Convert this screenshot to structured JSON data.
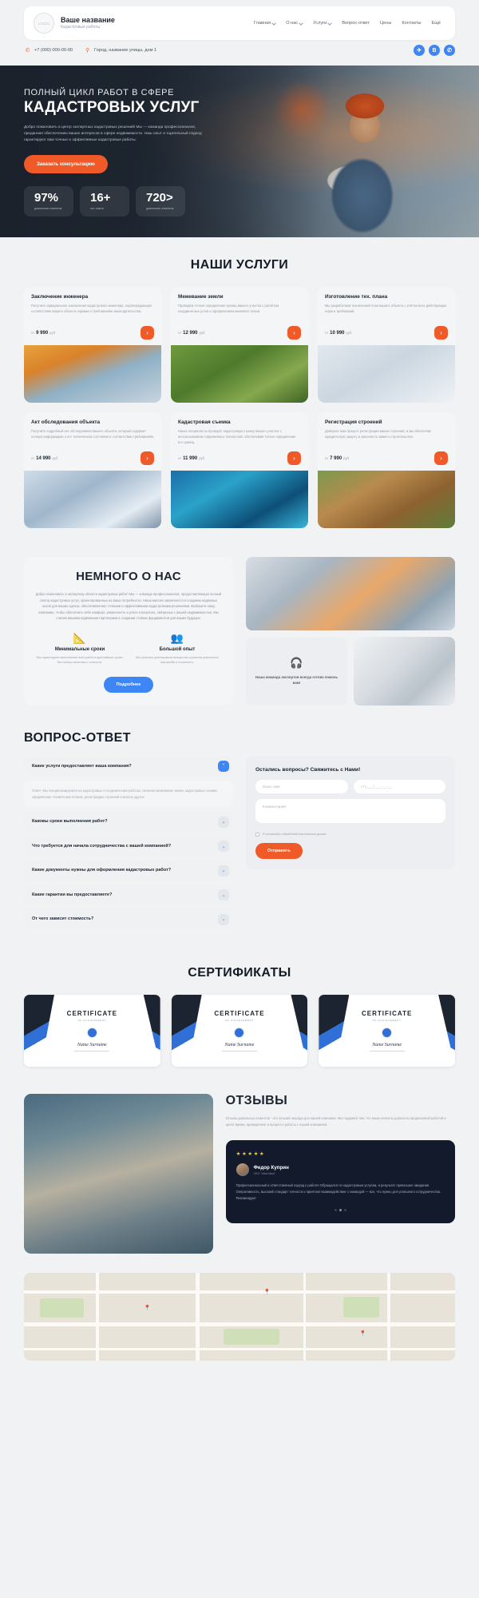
{
  "header": {
    "logo_text": "LOGO",
    "brand_name": "Ваше название",
    "brand_sub": "Кадастровые работы",
    "nav": [
      {
        "label": "Главная",
        "has_chevron": true
      },
      {
        "label": "О нас",
        "has_chevron": true
      },
      {
        "label": "Услуги",
        "has_chevron": true
      },
      {
        "label": "Вопрос-ответ",
        "has_chevron": false
      },
      {
        "label": "Цены",
        "has_chevron": false
      },
      {
        "label": "Контакты",
        "has_chevron": false
      },
      {
        "label": "Ещё",
        "has_chevron": false
      }
    ],
    "phone": "+7 (000) 000-00-00",
    "phone_icon": "phone-icon",
    "address": "Город, название улицы, дом 1",
    "address_icon": "location-pin-icon",
    "socials": [
      {
        "name": "telegram-icon",
        "glyph": "✈"
      },
      {
        "name": "vk-icon",
        "glyph": "В"
      },
      {
        "name": "whatsapp-icon",
        "glyph": "✆"
      }
    ]
  },
  "hero": {
    "superline": "ПОЛНЫЙ ЦИКЛ РАБОТ В СФЕРЕ",
    "title": "КАДАСТРОВЫХ УСЛУГ",
    "description": "Добро пожаловать в центр экспертных кадастровых решений! Мы — команда профессионалов, преданная обеспечению ваших интересов в сфере недвижимости. Наш опыт и тщательный подход гарантируют вам точные и эффективные кадастровые работы.",
    "cta_label": "Заказать консультацию",
    "stats": [
      {
        "value": "97%",
        "label": "довольных клиентов"
      },
      {
        "value": "16+",
        "label": "лет опыта"
      },
      {
        "value": "720>",
        "label": "довольных клиентов"
      }
    ]
  },
  "services": {
    "title": "НАШИ УСЛУГИ",
    "price_prefix": "от",
    "currency": "руб",
    "arrow_glyph": "›",
    "items": [
      {
        "title": "Заключение инженера",
        "desc": "Получите официальное заключение кадастрового инженера, подтверждающее соответствие вашего объекта нормам и требованиям законодательства.",
        "price": "9 990"
      },
      {
        "title": "Межевание земли",
        "desc": "Проведём точное определение границ вашего участка с расчётом координатных углов и оформлением межевого плана.",
        "price": "12 990"
      },
      {
        "title": "Изготовление тех. плана",
        "desc": "Мы разработаем технический план вашего объекта с учётом всех действующих норм и требований.",
        "price": "10 990"
      },
      {
        "title": "Акт обследования объекта",
        "desc": "Получите подробный акт обследования вашего объекта, который содержит полную информацию о его техническом состоянии и соответствии требованиям.",
        "price": "14 990"
      },
      {
        "title": "Кадастровая съемка",
        "desc": "Наша специалисты проводят кадастровую съемку вашего участка с использованием современных технологий, обеспечивая точное определение его границ.",
        "price": "11 990"
      },
      {
        "title": "Регистрация строений",
        "desc": "Доверьте нам процесс регистрации ваших строений, и мы обеспечим юридическую защиту и законность вашего строительства.",
        "price": "7 990"
      }
    ]
  },
  "about": {
    "title": "НЕМНОГО О НАС",
    "text": "Добро пожаловать в экспертизу области кадастровых работ! Мы — команда профессионалов, предоставляющая полный спектр кадастровых услуг, ориентированных на ваши потребности. Наша миссия заключается в создании надёжных основ для ваших сделок, обеспечивая вас точными и эффективными кадастровыми решениями. Выберите нашу компанию, чтобы обеспечить себе комфорт, уверенность и успех в вопросах, связанных с вашей недвижимостью. Мы станем вашими надёжными партнёрами в создании стойких фундаментов для ваших будущих.",
    "features": [
      {
        "icon": "blueprint-ruler-icon",
        "glyph": "📐",
        "title": "Минимальные сроки",
        "desc": "Мы гарантируем выполнение всех работ в кратчайшие сроки, без потери качества и точности."
      },
      {
        "icon": "team-experience-icon",
        "glyph": "👥",
        "title": "Большой опыт",
        "desc": "Мы успешно реализовали множество проектов различного масштаба и сложности."
      }
    ],
    "more_label": "Подробнее",
    "cta_icon": "headset-icon",
    "cta_glyph": "🎧",
    "cta_text": "Наша команда экспертов всегда готова помочь вам!"
  },
  "faq": {
    "title": "ВОПРОС-ОТВЕТ",
    "expand_glyph": "⌃",
    "collapse_glyph": "⌄",
    "items": [
      {
        "question": "Какие услуги предоставляет ваша компания?",
        "open": true,
        "answer": "Ответ: Мы специализируемся на кадастровых и геодезических работах, включая межевание земли, кадастровые съемки, оформление технических планов, регистрацию строений и многое другое."
      },
      {
        "question": "Каковы сроки выполнения работ?",
        "open": false,
        "answer": ""
      },
      {
        "question": "Что требуется для начала сотрудничества с вашей компанией?",
        "open": false,
        "answer": ""
      },
      {
        "question": "Какие документы нужны для оформления кадастровых работ?",
        "open": false,
        "answer": ""
      },
      {
        "question": "Какие гарантии вы предоставляете?",
        "open": false,
        "answer": ""
      },
      {
        "question": "От чего зависит стоимость?",
        "open": false,
        "answer": ""
      }
    ],
    "form": {
      "title": "Остались вопросы? Свяжитесь с Нами!",
      "name_placeholder": "Ваше имя",
      "phone_placeholder": "+7 (___) ___-__-__",
      "comment_placeholder": "Комментарий",
      "agree_text": "Я согласен(а) с обработкой персональных данных",
      "submit_label": "Отправить"
    }
  },
  "certificates": {
    "title": "СЕРТИФИКАТЫ",
    "items": [
      {
        "heading": "CERTIFICATE",
        "sub": "OF ACHIEVEMENT",
        "name": "Name Surname"
      },
      {
        "heading": "CERTIFICATE",
        "sub": "OF ACHIEVEMENT",
        "name": "Name Surname"
      },
      {
        "heading": "CERTIFICATE",
        "sub": "OF ACHIEVEMENT",
        "name": "Name Surname"
      }
    ]
  },
  "reviews": {
    "title": "ОТЗЫВЫ",
    "subtitle": "Отзывы довольных клиентов - это лучшая награда для нашей компании. Мы гордимся тем, что наши клиенты довольны проделанной работой и ценят время, проведённое в процессе работы с нашей компанией.",
    "card": {
      "stars": "★★★★★",
      "name": "Федор Куприн",
      "role": "CEO \"Ultra Maxi\"",
      "text": "Профессиональный и ответственный подход к работе! Обращался по кадастровым услугам, и результат превзошел ожидания. Оперативность, высокий стандарт точности и приятное взаимодействие с командой — все, что нужно для успешного сотрудничества. Рекомендую!"
    },
    "dots": [
      false,
      true,
      false
    ]
  },
  "map": {
    "pin_glyph": "📍"
  }
}
